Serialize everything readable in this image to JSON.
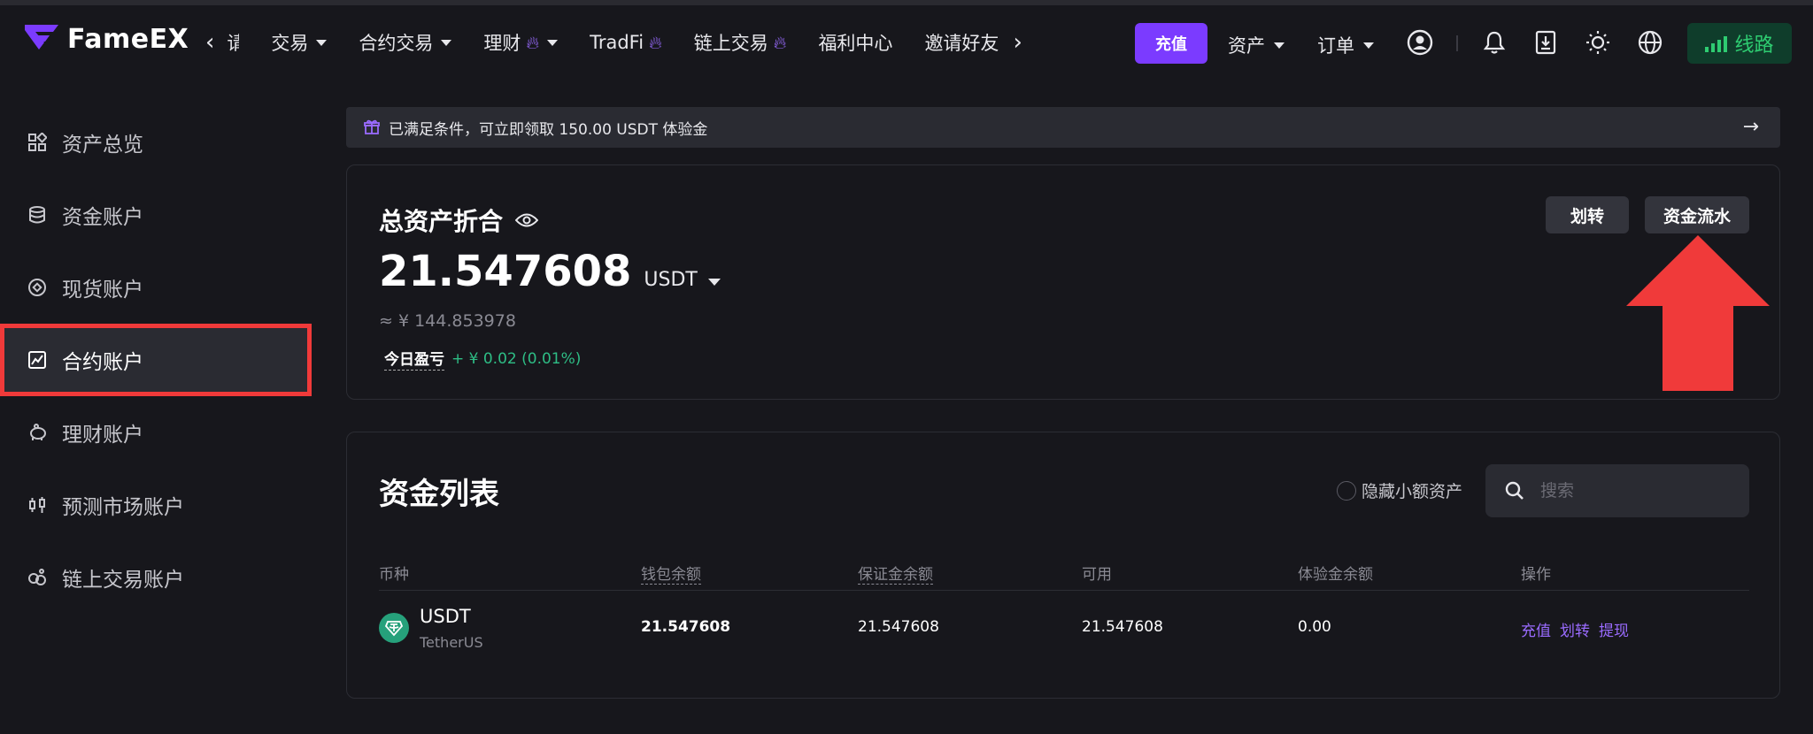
{
  "header": {
    "brand": "FameEX",
    "nav": [
      {
        "label": "交易",
        "caret": true,
        "fire": false
      },
      {
        "label": "合约交易",
        "caret": true,
        "fire": false
      },
      {
        "label": "理财",
        "caret": true,
        "fire": true
      },
      {
        "label": "TradFi",
        "caret": false,
        "fire": true
      },
      {
        "label": "链上交易",
        "caret": false,
        "fire": true
      },
      {
        "label": "福利中心",
        "caret": false,
        "fire": false
      },
      {
        "label": "邀请好友",
        "caret": false,
        "fire": false
      }
    ],
    "nav_truncated": "请",
    "deposit": "充值",
    "assets": "资产",
    "orders": "订单",
    "line": "线路"
  },
  "sidebar": {
    "items": [
      {
        "label": "资产总览",
        "icon": "grid-icon"
      },
      {
        "label": "资金账户",
        "icon": "database-icon"
      },
      {
        "label": "现货账户",
        "icon": "target-icon"
      },
      {
        "label": "合约账户",
        "icon": "contract-chart-icon",
        "active": true
      },
      {
        "label": "理财账户",
        "icon": "piggy-bank-icon"
      },
      {
        "label": "预测市场账户",
        "icon": "candlestick-icon"
      },
      {
        "label": "链上交易账户",
        "icon": "chain-icon"
      }
    ]
  },
  "banner": {
    "text": "已满足条件，可立即领取 150.00 USDT 体验金"
  },
  "summary": {
    "title": "总资产折合",
    "amount": "21.547608",
    "unit": "USDT",
    "approx": "≈ ¥ 144.853978",
    "pnl_label": "今日盈亏",
    "pnl_value": "+ ¥ 0.02 (0.01%)",
    "transfer": "划转",
    "flow": "资金流水"
  },
  "list": {
    "title": "资金列表",
    "hide_small": "隐藏小额资产",
    "search_placeholder": "搜索",
    "columns": [
      "币种",
      "钱包余额",
      "保证金余额",
      "可用",
      "体验金余额",
      "操作"
    ],
    "rows": [
      {
        "coin": "USDT",
        "coin_full": "TetherUS",
        "wallet": "21.547608",
        "margin": "21.547608",
        "available": "21.547608",
        "trial": "0.00",
        "actions": [
          "充值",
          "划转",
          "提现"
        ]
      }
    ]
  },
  "colors": {
    "accent": "#7b3bff",
    "highlight": "#f03a3a",
    "positive": "#2ebd85",
    "line_green": "#2ecc71"
  }
}
